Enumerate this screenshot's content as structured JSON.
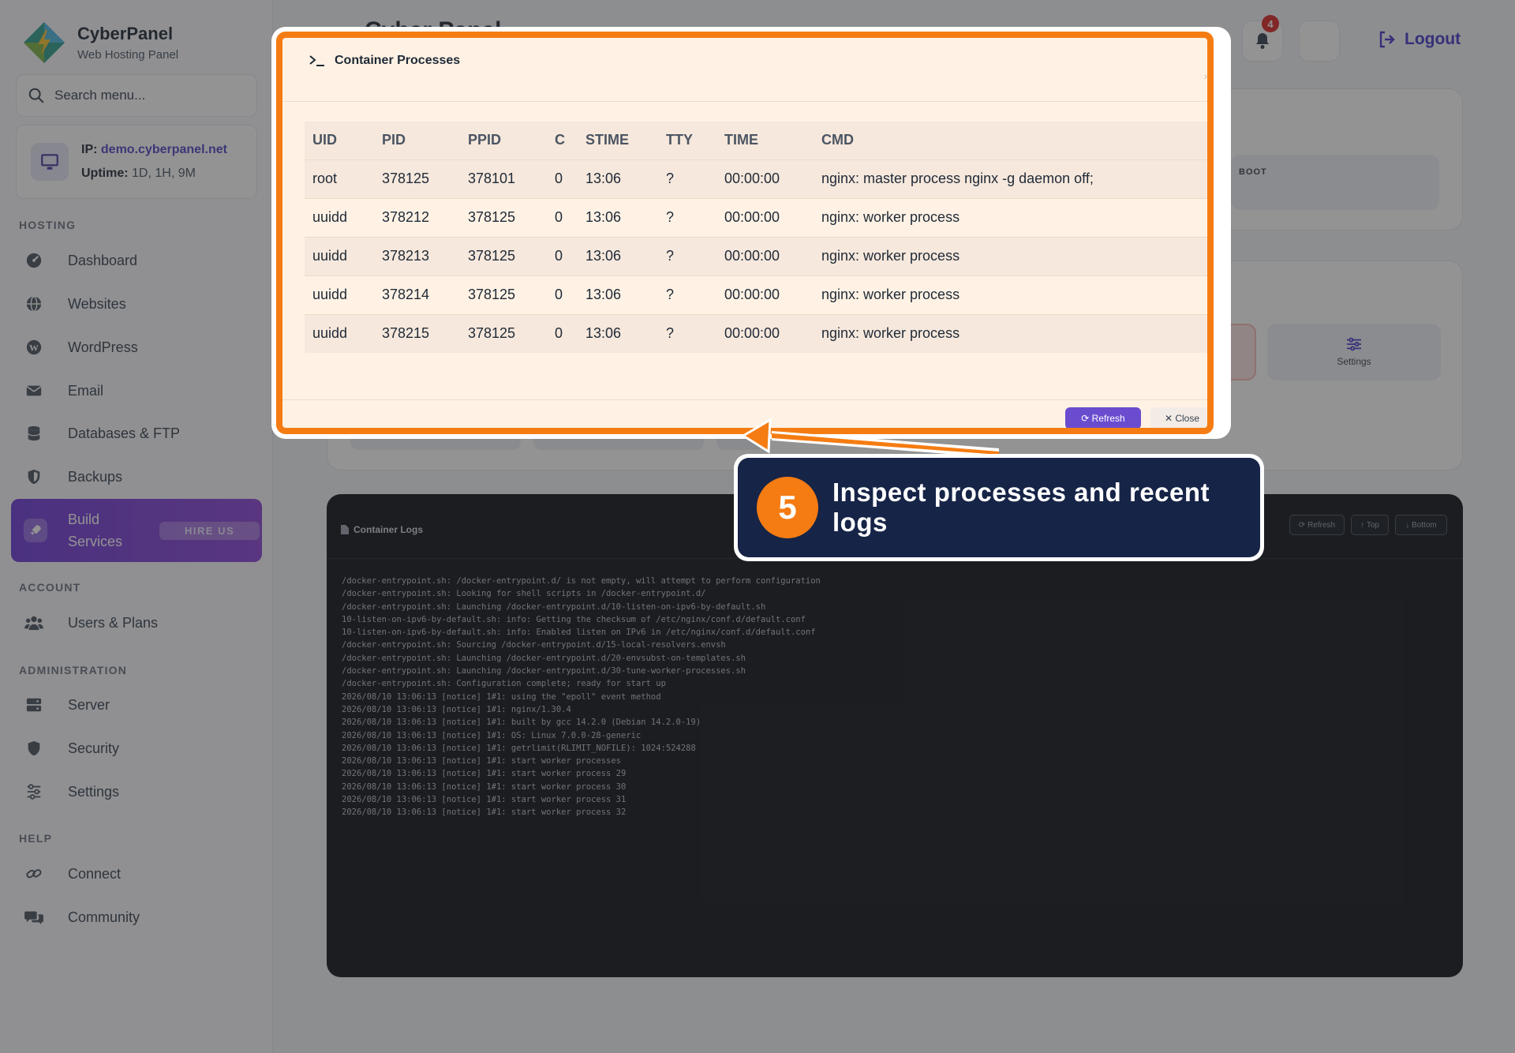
{
  "brand": {
    "name": "CyberPanel",
    "subtitle": "Web Hosting Panel"
  },
  "search": {
    "placeholder": "Search menu..."
  },
  "server_info": {
    "ip_label": "IP:",
    "ip_value": "demo.cyberpanel.net",
    "uptime_label": "Uptime:",
    "uptime_value": "1D, 1H, 9M"
  },
  "sections": {
    "hosting": "HOSTING",
    "account": "ACCOUNT",
    "administration": "ADMINISTRATION",
    "help": "HELP"
  },
  "nav": {
    "dashboard": "Dashboard",
    "websites": "Websites",
    "wordpress": "WordPress",
    "email": "Email",
    "databases": "Databases & FTP",
    "backups": "Backups",
    "build_services": "Build Services",
    "hire_us": "HIRE US",
    "users": "Users & Plans",
    "server": "Server",
    "security": "Security",
    "settings": "Settings",
    "connect": "Connect",
    "community": "Community"
  },
  "header": {
    "title": "Cyber Panel",
    "notifications_count": "4",
    "logout": "Logout"
  },
  "background": {
    "boot_label": "BOOT",
    "settings_tile": "Settings"
  },
  "modal": {
    "title": "Container Processes",
    "columns": [
      "UID",
      "PID",
      "PPID",
      "C",
      "STIME",
      "TTY",
      "TIME",
      "CMD"
    ],
    "rows": [
      [
        "root",
        "378125",
        "378101",
        "0",
        "13:06",
        "?",
        "00:00:00",
        "nginx: master process nginx -g daemon off;"
      ],
      [
        "uuidd",
        "378212",
        "378125",
        "0",
        "13:06",
        "?",
        "00:00:00",
        "nginx: worker process"
      ],
      [
        "uuidd",
        "378213",
        "378125",
        "0",
        "13:06",
        "?",
        "00:00:00",
        "nginx: worker process"
      ],
      [
        "uuidd",
        "378214",
        "378125",
        "0",
        "13:06",
        "?",
        "00:00:00",
        "nginx: worker process"
      ],
      [
        "uuidd",
        "378215",
        "378125",
        "0",
        "13:06",
        "?",
        "00:00:00",
        "nginx: worker process"
      ]
    ],
    "refresh": "Refresh",
    "close": "Close"
  },
  "logs": {
    "title": "Container Logs",
    "refresh": "Refresh",
    "top": "Top",
    "bottom": "Bottom",
    "lines": [
      "/docker-entrypoint.sh: /docker-entrypoint.d/ is not empty, will attempt to perform configuration",
      "/docker-entrypoint.sh: Looking for shell scripts in /docker-entrypoint.d/",
      "/docker-entrypoint.sh: Launching /docker-entrypoint.d/10-listen-on-ipv6-by-default.sh",
      "10-listen-on-ipv6-by-default.sh: info: Getting the checksum of /etc/nginx/conf.d/default.conf",
      "10-listen-on-ipv6-by-default.sh: info: Enabled listen on IPv6 in /etc/nginx/conf.d/default.conf",
      "/docker-entrypoint.sh: Sourcing /docker-entrypoint.d/15-local-resolvers.envsh",
      "/docker-entrypoint.sh: Launching /docker-entrypoint.d/20-envsubst-on-templates.sh",
      "/docker-entrypoint.sh: Launching /docker-entrypoint.d/30-tune-worker-processes.sh",
      "/docker-entrypoint.sh: Configuration complete; ready for start up",
      "2026/08/10 13:06:13 [notice] 1#1: using the \"epoll\" event method",
      "2026/08/10 13:06:13 [notice] 1#1: nginx/1.30.4",
      "2026/08/10 13:06:13 [notice] 1#1: built by gcc 14.2.0 (Debian 14.2.0-19)",
      "2026/08/10 13:06:13 [notice] 1#1: OS: Linux 7.0.0-28-generic",
      "2026/08/10 13:06:13 [notice] 1#1: getrlimit(RLIMIT_NOFILE): 1024:524288",
      "2026/08/10 13:06:13 [notice] 1#1: start worker processes",
      "2026/08/10 13:06:13 [notice] 1#1: start worker process 29",
      "2026/08/10 13:06:13 [notice] 1#1: start worker process 30",
      "2026/08/10 13:06:13 [notice] 1#1: start worker process 31",
      "2026/08/10 13:06:13 [notice] 1#1: start worker process 32"
    ]
  },
  "callout": {
    "step": "5",
    "text": "Inspect processes and recent logs"
  },
  "colors": {
    "accent": "#f57c12",
    "primary": "#6a4ccf",
    "callout_bg": "#162447",
    "build_gradient_start": "#6d3bd8"
  }
}
